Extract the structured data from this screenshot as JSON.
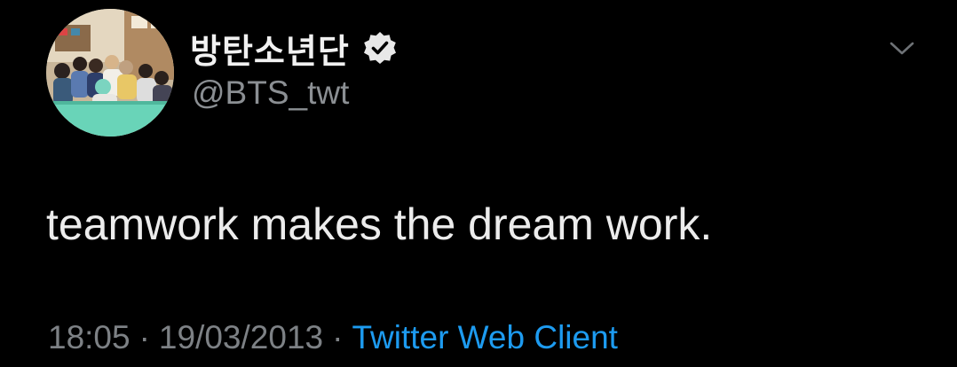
{
  "tweet": {
    "author": {
      "display_name": "방탄소년단",
      "handle": "@BTS_twt",
      "verified": true,
      "avatar_icon": "profile-photo-group"
    },
    "text": "teamwork makes the dream work.",
    "meta": {
      "time": "18:05",
      "separator": "·",
      "date": "19/03/2013",
      "client": "Twitter Web Client"
    },
    "menu_icon": "chevron-down-icon"
  },
  "colors": {
    "background": "#000000",
    "primary_text": "#ececec",
    "secondary_text": "#8b8f93",
    "link": "#1d9bf0"
  }
}
